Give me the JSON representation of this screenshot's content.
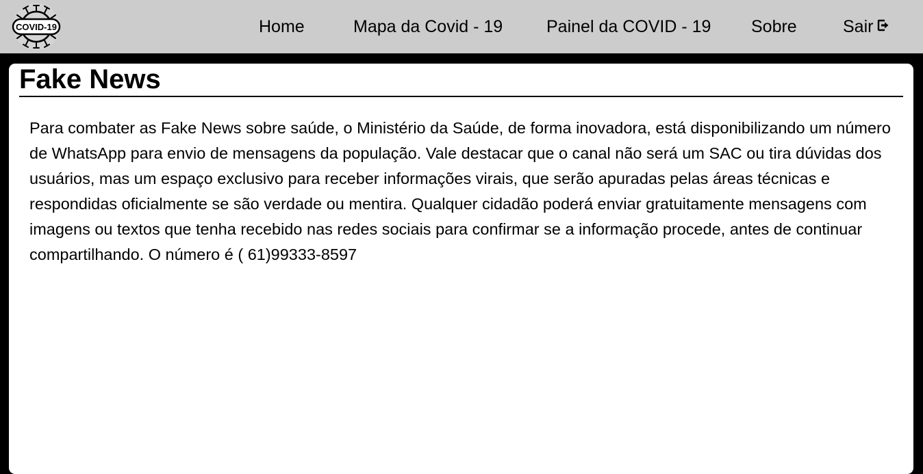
{
  "header": {
    "logo_text": "COVID-19",
    "nav": {
      "home": "Home",
      "mapa": "Mapa da Covid - 19",
      "painel": "Painel da COVID - 19",
      "sobre": "Sobre",
      "sair": "Sair"
    },
    "icons": {
      "logo": "covid-virus-logo",
      "sair": "exit-icon"
    }
  },
  "main": {
    "title": "Fake News",
    "body": "Para combater as Fake News sobre saúde, o Ministério da Saúde, de forma inovadora, está disponibilizando um número de WhatsApp para envio de mensagens da população. Vale destacar que o canal não será um SAC ou tira dúvidas dos usuários, mas um espaço exclusivo para receber informações virais, que serão apuradas pelas áreas técnicas e respondidas oficialmente se são verdade ou mentira. Qualquer cidadão poderá enviar gratuitamente mensagens com imagens ou textos que tenha recebido nas redes sociais para confirmar se a informação procede, antes de continuar compartilhando. O número é ( 61)99333-8597"
  },
  "colors": {
    "header_bg": "#cccccc",
    "page_bg": "#000000",
    "card_bg": "#ffffff",
    "text": "#000000"
  }
}
